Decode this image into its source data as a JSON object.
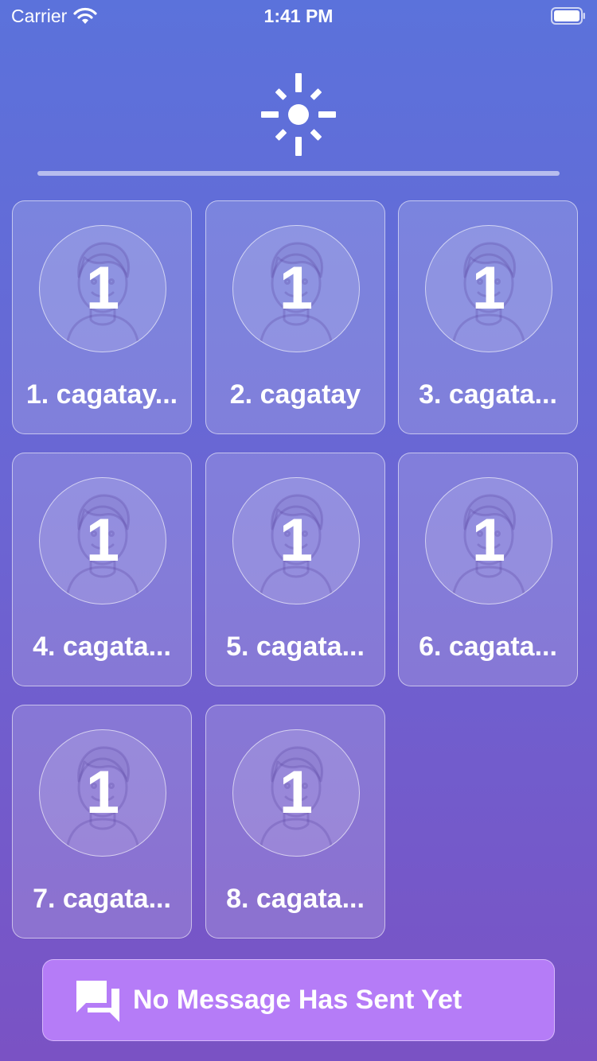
{
  "status_bar": {
    "carrier": "Carrier",
    "time": "1:41 PM"
  },
  "header": {
    "icon": "sun-icon"
  },
  "players": [
    {
      "rank_badge": "1",
      "name": "1. cagatay..."
    },
    {
      "rank_badge": "1",
      "name": "2. cagatay"
    },
    {
      "rank_badge": "1",
      "name": "3. cagata..."
    },
    {
      "rank_badge": "1",
      "name": "4. cagata..."
    },
    {
      "rank_badge": "1",
      "name": "5. cagata..."
    },
    {
      "rank_badge": "1",
      "name": "6. cagata..."
    },
    {
      "rank_badge": "1",
      "name": "7. cagata..."
    },
    {
      "rank_badge": "1",
      "name": "8. cagata..."
    }
  ],
  "message_button": {
    "icon": "chat-bubbles-icon",
    "label": "No Message Has Sent Yet"
  },
  "colors": {
    "background_top": "#5b72db",
    "background_bottom": "#7a52c4",
    "button": "#b57cf7",
    "text": "#ffffff"
  }
}
